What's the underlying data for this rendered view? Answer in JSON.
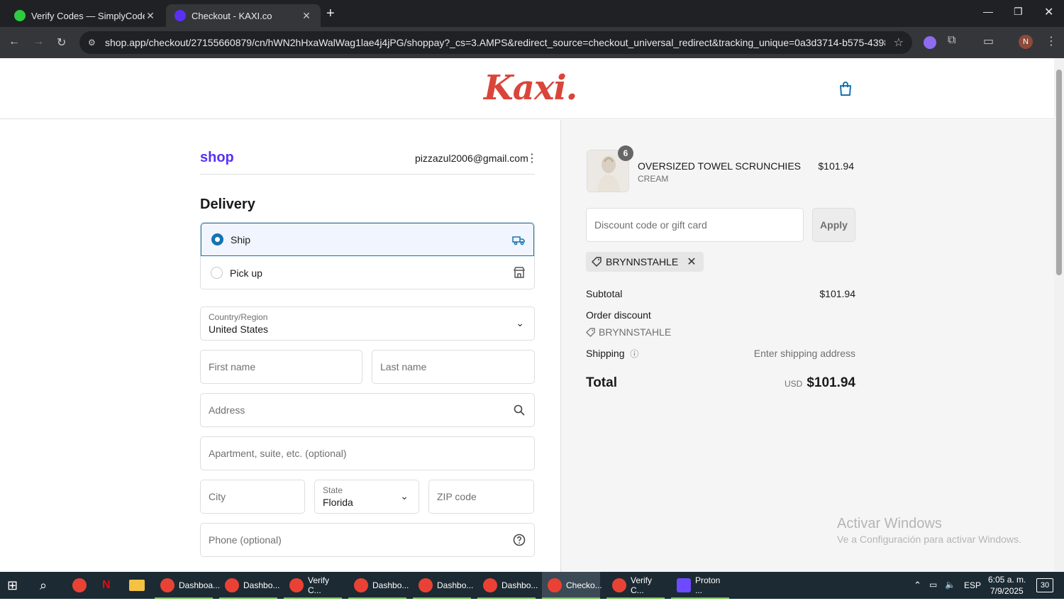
{
  "browser": {
    "tabs": [
      {
        "title": "Verify Codes — SimplyCodes",
        "active": false,
        "favicon_color": "#2ecc40"
      },
      {
        "title": "Checkout - KAXI.co",
        "active": true,
        "favicon_color": "#5a31f4"
      }
    ],
    "url": "shop.app/checkout/27155660879/cn/hWN2hHxaWalWag1lae4j4jPG/shoppay?_cs=3.AMPS&redirect_source=checkout_universal_redirect&tracking_unique=0a3d3714-b575-4398-9ee3-e47...",
    "profile_initial": "N"
  },
  "store": {
    "logo_text": "Kaxi.",
    "logo_color": "#d9453a"
  },
  "account": {
    "shop_label": "shop",
    "email": "pizzazul2006@gmail.com"
  },
  "delivery": {
    "heading": "Delivery",
    "options": [
      {
        "label": "Ship",
        "selected": true
      },
      {
        "label": "Pick up",
        "selected": false
      }
    ],
    "country_label": "Country/Region",
    "country_value": "United States",
    "first_name_placeholder": "First name",
    "last_name_placeholder": "Last name",
    "address_placeholder": "Address",
    "apartment_placeholder": "Apartment, suite, etc. (optional)",
    "city_placeholder": "City",
    "state_label": "State",
    "state_value": "Florida",
    "zip_placeholder": "ZIP code",
    "phone_placeholder": "Phone (optional)"
  },
  "summary": {
    "item": {
      "quantity": "6",
      "name": "OVERSIZED TOWEL SCRUNCHIES",
      "variant": "CREAM",
      "price": "$101.94"
    },
    "discount_placeholder": "Discount code or gift card",
    "apply_label": "Apply",
    "applied_code": "BRYNNSTAHLE",
    "subtotal_label": "Subtotal",
    "subtotal_value": "$101.94",
    "order_discount_label": "Order discount",
    "order_discount_code": "BRYNNSTAHLE",
    "shipping_label": "Shipping",
    "shipping_value": "Enter shipping address",
    "total_label": "Total",
    "currency": "USD",
    "total_value": "$101.94"
  },
  "watermark": {
    "line1": "Activar Windows",
    "line2": "Ve a Configuración para activar Windows."
  },
  "taskbar": {
    "apps": [
      {
        "label": "Dashboa...",
        "color": "#e94235"
      },
      {
        "label": "Dashbo...",
        "color": "#e94235"
      },
      {
        "label": "Verify C...",
        "color": "#e94235"
      },
      {
        "label": "Dashbo...",
        "color": "#e94235"
      },
      {
        "label": "Dashbo...",
        "color": "#e94235"
      },
      {
        "label": "Dashbo...",
        "color": "#e94235"
      },
      {
        "label": "Checko...",
        "color": "#e94235"
      },
      {
        "label": "Verify C...",
        "color": "#e94235"
      },
      {
        "label": "Proton ...",
        "color": "#6d4aff"
      }
    ],
    "language": "ESP",
    "time": "6:05 a. m.",
    "date": "7/9/2025",
    "notifications": "30"
  }
}
